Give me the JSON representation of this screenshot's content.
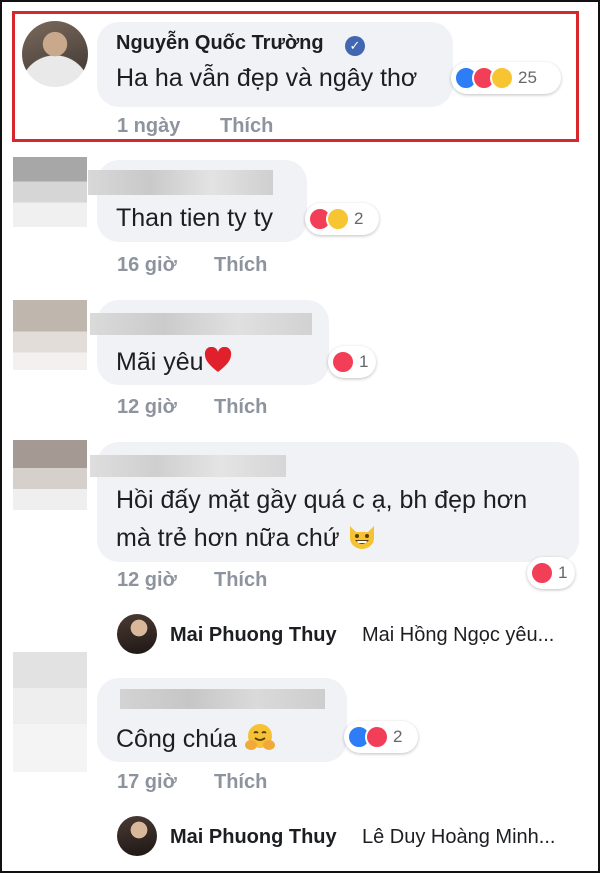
{
  "comments": [
    {
      "author": "Nguyễn Quốc Trường",
      "verified": true,
      "text": "Ha ha vẫn đẹp và ngây thơ",
      "time": "1 ngày",
      "like_label": "Thích",
      "reactions": [
        "like",
        "love",
        "haha"
      ],
      "reaction_count": "25"
    },
    {
      "author": "",
      "text": "Than tien ty ty",
      "time": "16 giờ",
      "like_label": "Thích",
      "reactions": [
        "love",
        "haha"
      ],
      "reaction_count": "2"
    },
    {
      "author": "",
      "text": "Mãi yêu",
      "emoji": "red-heart",
      "time": "12 giờ",
      "like_label": "Thích",
      "reactions": [
        "love"
      ],
      "reaction_count": "1"
    },
    {
      "author": "",
      "text_line1": "Hồi đấy mặt gầy quá c ạ, bh đẹp hơn",
      "text_line2": "mà trẻ hơn nữa chứ",
      "emoji": "grinning-cat",
      "time": "12 giờ",
      "like_label": "Thích",
      "reactions": [
        "love"
      ],
      "reaction_count": "1",
      "reply": {
        "author": "Mai Phuong Thuy",
        "text": "Mai Hồng Ngọc yêu..."
      }
    },
    {
      "author": "",
      "text": "Công chúa",
      "emoji": "hugging-face",
      "time": "17 giờ",
      "like_label": "Thích",
      "reactions": [
        "like",
        "love"
      ],
      "reaction_count": "2",
      "reply": {
        "author": "Mai Phuong Thuy",
        "text": "Lê Duy Hoàng Minh..."
      }
    }
  ],
  "colors": {
    "highlight_border": "#d8262d",
    "bubble": "#f0f2f5",
    "meta_text": "#8d949e",
    "like_blue": "#2d7df6",
    "love_red": "#f33e58",
    "haha_yellow": "#f7c531"
  }
}
